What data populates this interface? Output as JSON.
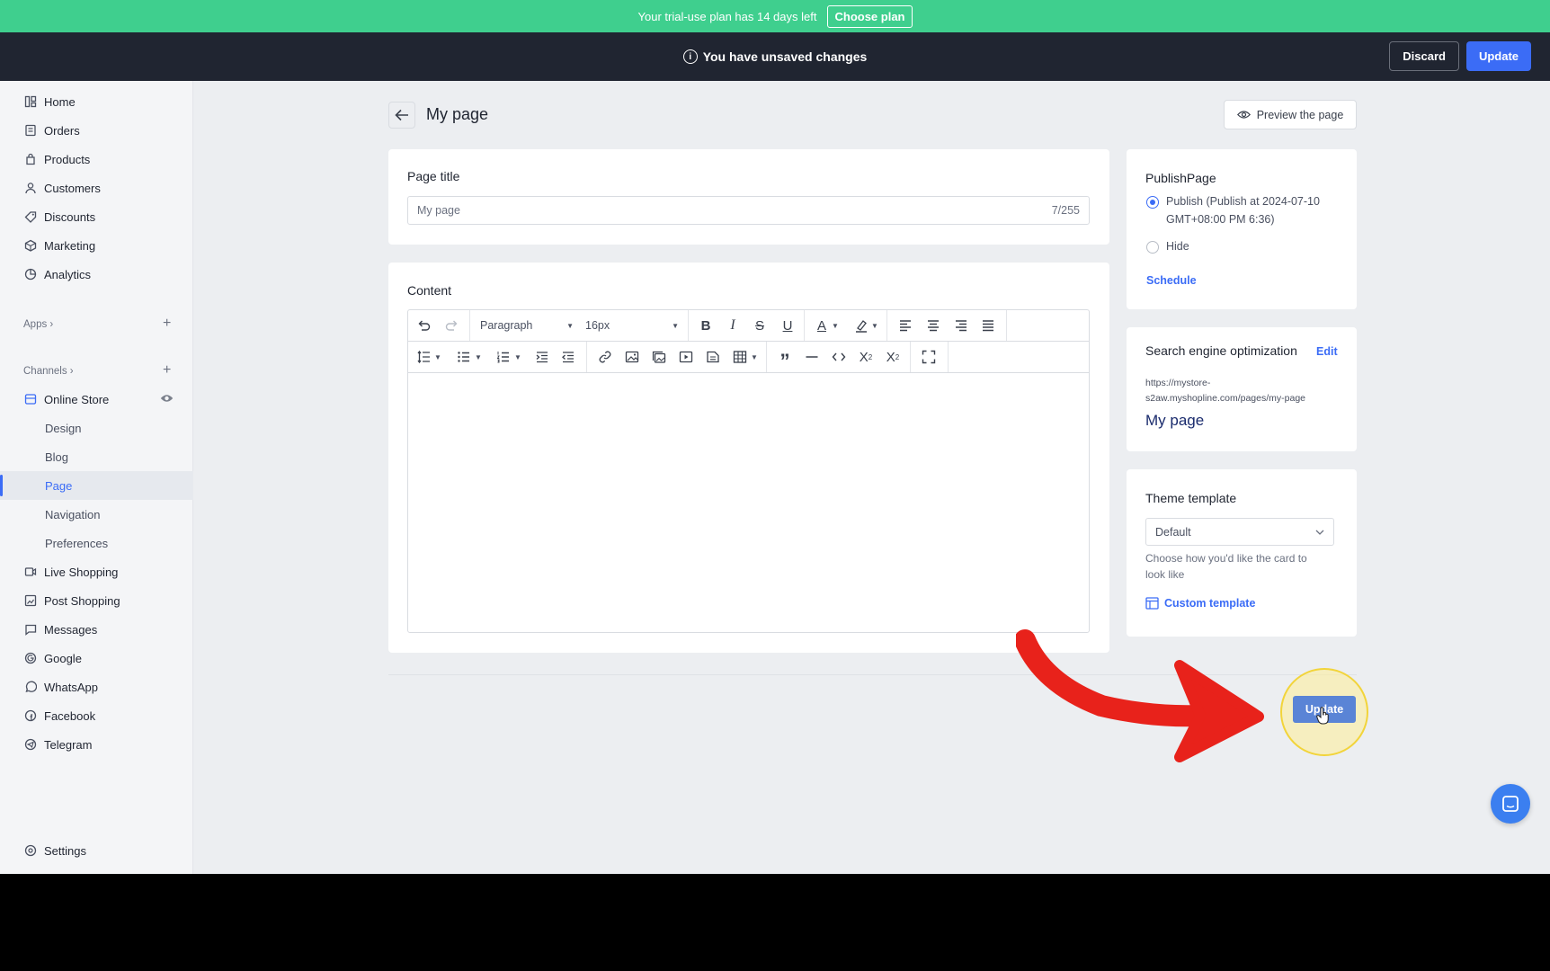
{
  "banner": {
    "text": "Your trial-use plan has 14 days left",
    "cta": "Choose plan"
  },
  "unsaved_bar": {
    "message": "You have unsaved changes",
    "discard": "Discard",
    "update": "Update"
  },
  "sidebar": {
    "items": [
      {
        "label": "Home",
        "icon": "home-icon"
      },
      {
        "label": "Orders",
        "icon": "orders-icon"
      },
      {
        "label": "Products",
        "icon": "products-icon"
      },
      {
        "label": "Customers",
        "icon": "customers-icon"
      },
      {
        "label": "Discounts",
        "icon": "discounts-icon"
      },
      {
        "label": "Marketing",
        "icon": "marketing-icon"
      },
      {
        "label": "Analytics",
        "icon": "analytics-icon"
      }
    ],
    "apps_label": "Apps",
    "channels_label": "Channels",
    "online_store": "Online Store",
    "online_store_sub": [
      "Design",
      "Blog",
      "Page",
      "Navigation",
      "Preferences"
    ],
    "active_sub": "Page",
    "channel_items": [
      {
        "label": "Live Shopping",
        "icon": "live-shopping-icon"
      },
      {
        "label": "Post Shopping",
        "icon": "post-shopping-icon"
      },
      {
        "label": "Messages",
        "icon": "messages-icon"
      },
      {
        "label": "Google",
        "icon": "google-icon"
      },
      {
        "label": "WhatsApp",
        "icon": "whatsapp-icon"
      },
      {
        "label": "Facebook",
        "icon": "facebook-icon"
      },
      {
        "label": "Telegram",
        "icon": "telegram-icon"
      }
    ],
    "settings": "Settings"
  },
  "header": {
    "title": "My page",
    "preview": "Preview the page"
  },
  "page_title_card": {
    "label": "Page title",
    "value": "My page",
    "counter": "7/255"
  },
  "content_card": {
    "label": "Content",
    "block_format": "Paragraph",
    "font_size": "16px"
  },
  "publish_card": {
    "title": "PublishPage",
    "publish_label": "Publish",
    "publish_detail_line1": "(Publish at 2024-07-10",
    "publish_detail_line2": "GMT+08:00 PM 6:36)",
    "hide_label": "Hide",
    "schedule": "Schedule",
    "selected": "Publish"
  },
  "seo_card": {
    "title": "Search engine optimization",
    "edit": "Edit",
    "url_line1": "https://mystore-",
    "url_line2": "s2aw.myshopline.com/pages/my-page",
    "page_title": "My page"
  },
  "theme_card": {
    "title": "Theme template",
    "selected": "Default",
    "help_line1": "Choose how you'd like the card to",
    "help_line2": "look like",
    "custom_link": "Custom template"
  },
  "footer": {
    "update": "Update"
  },
  "colors": {
    "accent": "#3b6cf6",
    "banner": "#3fcf8e",
    "topbar": "#202531",
    "arrow": "#e8221b"
  }
}
